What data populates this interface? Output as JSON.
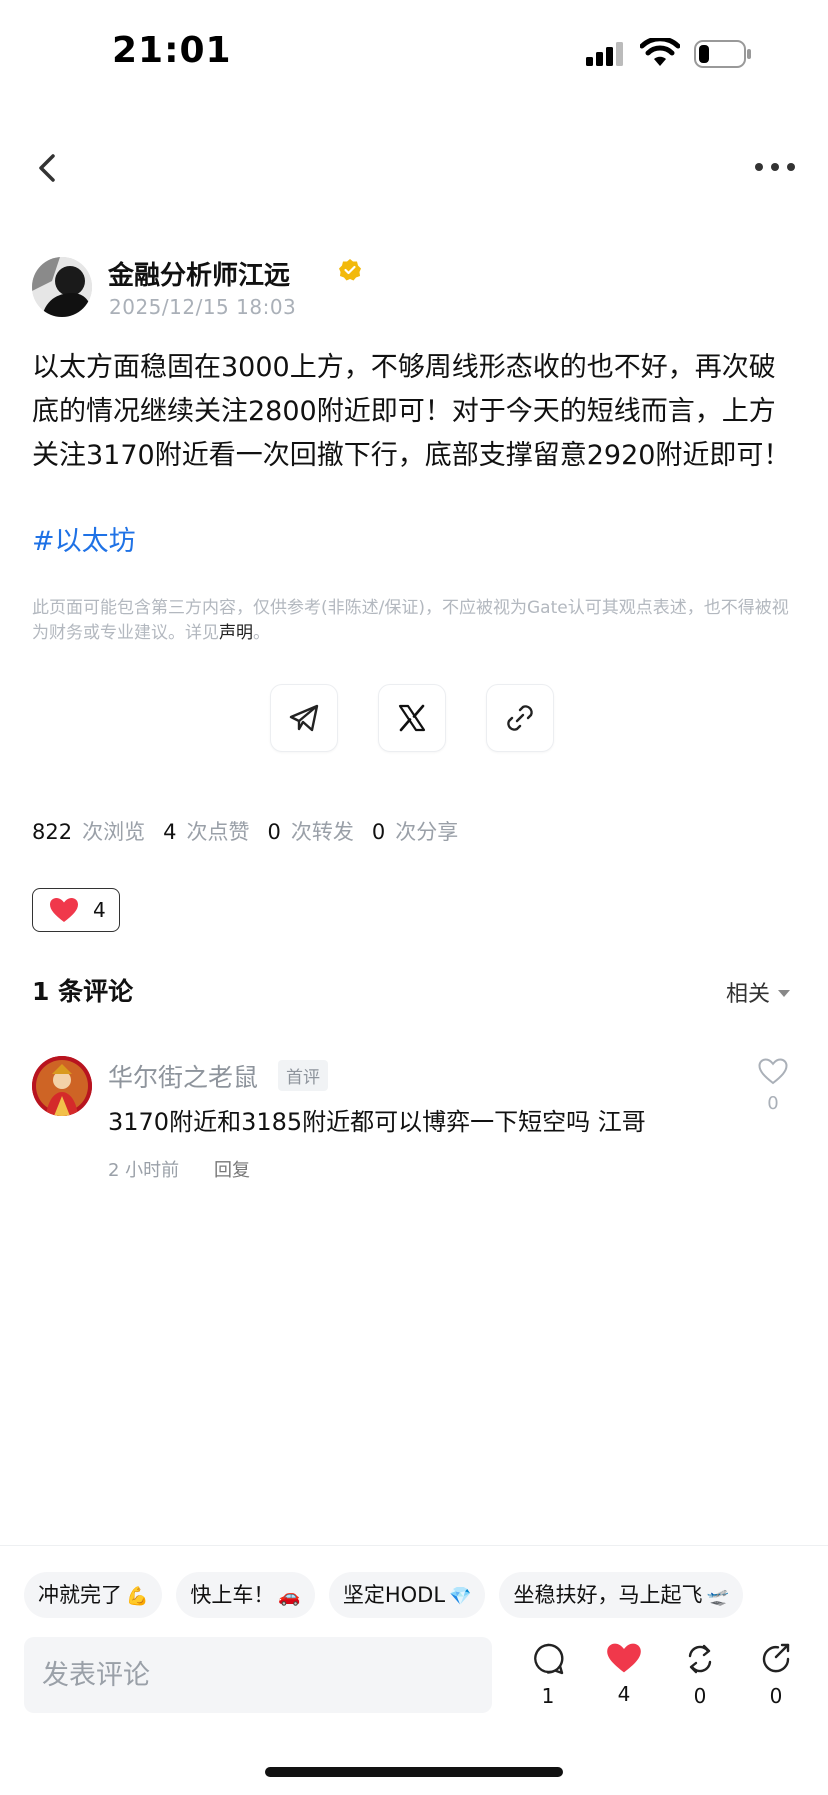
{
  "status_bar": {
    "time": "21:01"
  },
  "author": {
    "name": "金融分析师江远",
    "date": "2025/12/15 18:03"
  },
  "post": {
    "body": "以太方面稳固在3000上方，不够周线形态收的也不好，再次破底的情况继续关注2800附近即可！对于今天的短线而言，上方关注3170附近看一次回撤下行，底部支撑留意2920附近即可！",
    "hashtag": "#以太坊",
    "disclaimer": "此页面可能包含第三方内容，仅供参考(非陈述/保证)，不应被视为Gate认可其观点表述，也不得被视为财务或专业建议。详见",
    "disclaimer_link": "声明",
    "disclaimer_end": "。"
  },
  "stats": {
    "views": "822",
    "views_label": "次浏览",
    "likes": "4",
    "likes_label": "次点赞",
    "reposts": "0",
    "reposts_label": "次转发",
    "shares": "0",
    "shares_label": "次分享"
  },
  "reaction": {
    "count": "4"
  },
  "comments_section": {
    "title": "1 条评论",
    "sort": "相关",
    "items": [
      {
        "name": "华尔街之老鼠",
        "badge": "首评",
        "text": "3170附近和3185附近都可以博弈一下短空吗 江哥",
        "time": "2 小时前",
        "reply": "回复",
        "likes": "0"
      }
    ]
  },
  "quick_replies": [
    {
      "text": "冲就完了",
      "emoji": "💪"
    },
    {
      "text": "快上车！",
      "emoji": "🚗"
    },
    {
      "text": "坚定HODL",
      "emoji": "💎"
    },
    {
      "text": "坐稳扶好，马上起飞",
      "emoji": "🛫"
    }
  ],
  "composer": {
    "placeholder": "发表评论"
  },
  "bottom_actions": {
    "comments": "1",
    "likes": "4",
    "reposts": "0",
    "shares": "0"
  },
  "colors": {
    "accent_blue": "#1f72e6",
    "heart_red": "#f0384b",
    "verify_gold": "#f2b90c"
  }
}
